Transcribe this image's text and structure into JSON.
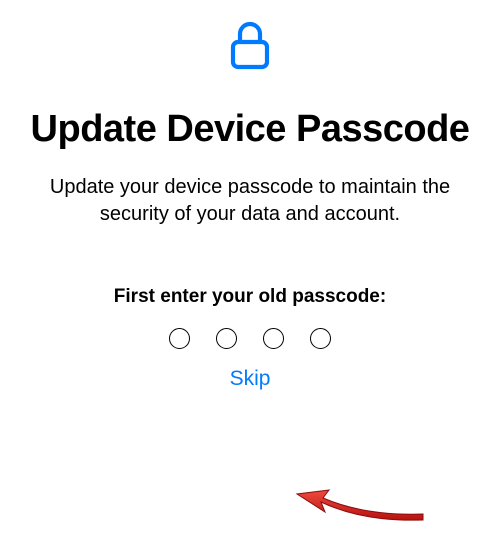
{
  "icon": "lock-icon",
  "title": "Update Device Passcode",
  "subtitle": "Update your device passcode to maintain the security of your data and account.",
  "prompt": "First enter your old passcode:",
  "passcode_length": 4,
  "skip_label": "Skip",
  "colors": {
    "accent": "#007aff",
    "text": "#000000",
    "arrow": "#d8201f"
  }
}
